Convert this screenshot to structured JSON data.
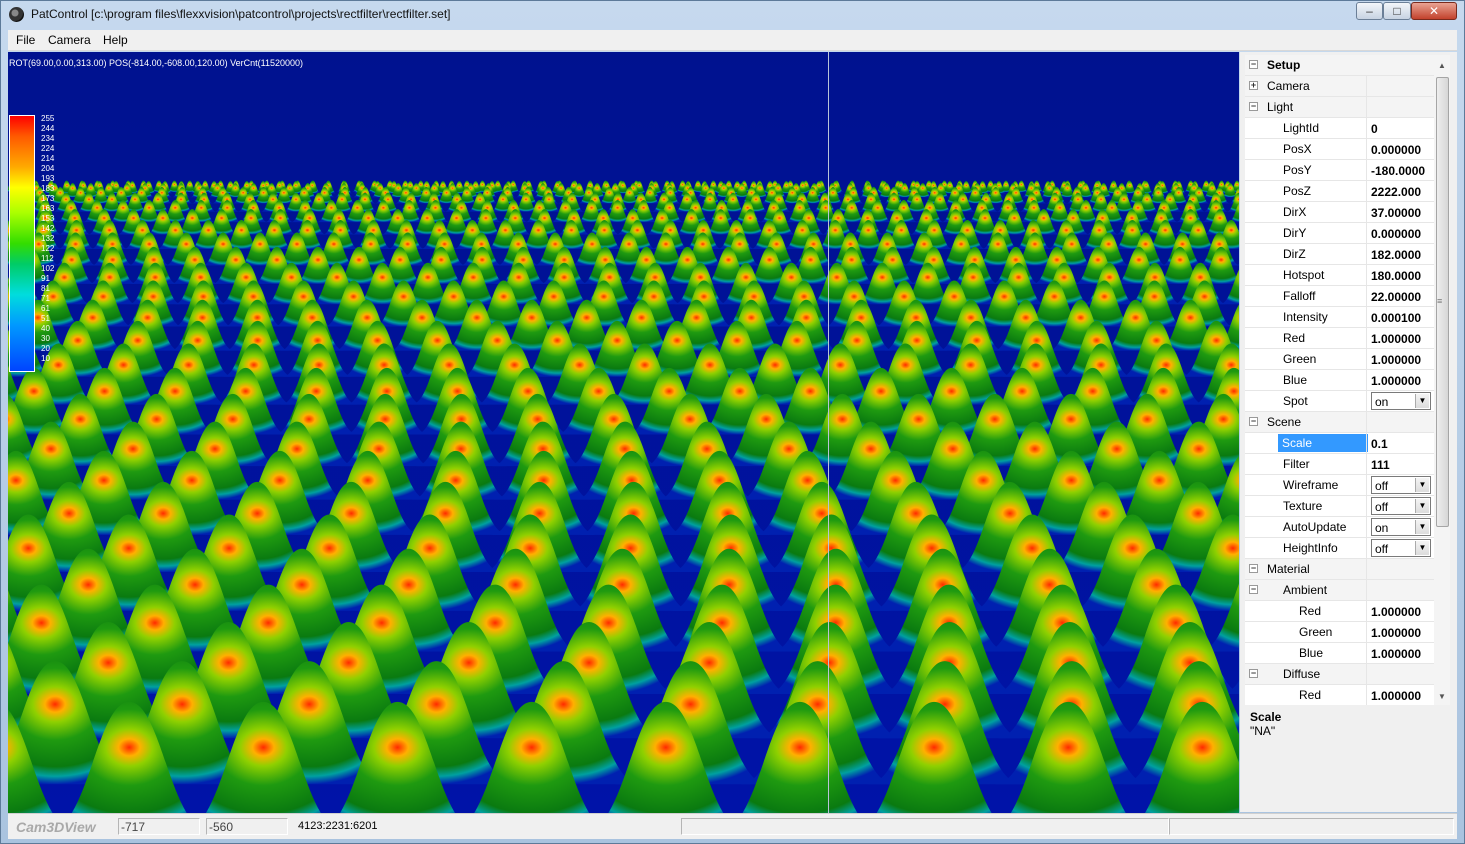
{
  "window": {
    "title": "PatControl [c:\\program files\\flexxvision\\patcontrol\\projects\\rectfilter\\rectfilter.set]",
    "controls": {
      "minimize": "–",
      "maximize": "□",
      "close": "✕"
    }
  },
  "menu": [
    "File",
    "Camera",
    "Help"
  ],
  "viewport": {
    "info": "ROT(69.00,0.00,313.00) POS(-814.00,-608.00,120.00) VerCnt(11520000)",
    "background_color": "#000fa0",
    "legend": [
      "255",
      "244",
      "234",
      "224",
      "214",
      "204",
      "193",
      "183",
      "173",
      "163",
      "153",
      "142",
      "132",
      "122",
      "112",
      "102",
      "91",
      "81",
      "71",
      "61",
      "51",
      "40",
      "30",
      "20",
      "10"
    ]
  },
  "properties": {
    "rows": [
      {
        "label": "Setup",
        "type": "header",
        "expander": "⊟"
      },
      {
        "label": "Camera",
        "type": "cat",
        "expander": "⊞"
      },
      {
        "label": "Light",
        "type": "cat",
        "expander": "⊟"
      },
      {
        "label": "LightId",
        "value": "0"
      },
      {
        "label": "PosX",
        "value": "0.000000"
      },
      {
        "label": "PosY",
        "value": "-180.0000"
      },
      {
        "label": "PosZ",
        "value": "2222.000"
      },
      {
        "label": "DirX",
        "value": "37.00000"
      },
      {
        "label": "DirY",
        "value": "0.000000"
      },
      {
        "label": "DirZ",
        "value": "182.0000"
      },
      {
        "label": "Hotspot",
        "value": "180.0000"
      },
      {
        "label": "Falloff",
        "value": "22.00000"
      },
      {
        "label": "Intensity",
        "value": "0.000100"
      },
      {
        "label": "Red",
        "value": "1.000000"
      },
      {
        "label": "Green",
        "value": "1.000000"
      },
      {
        "label": "Blue",
        "value": "1.000000"
      },
      {
        "label": "Spot",
        "dropdown": "on"
      },
      {
        "label": "Scene",
        "type": "cat",
        "expander": "⊟"
      },
      {
        "label": "Scale",
        "value": "0.1",
        "selected": true
      },
      {
        "label": "Filter",
        "value": "111"
      },
      {
        "label": "Wireframe",
        "dropdown": "off"
      },
      {
        "label": "Texture",
        "dropdown": "off"
      },
      {
        "label": "AutoUpdate",
        "dropdown": "on"
      },
      {
        "label": "HeightInfo",
        "dropdown": "off"
      },
      {
        "label": "Material",
        "type": "cat",
        "expander": "⊟"
      },
      {
        "label": "Ambient",
        "type": "subcat",
        "expander": "⊟"
      },
      {
        "label": "Red",
        "value": "1.000000",
        "level": 2
      },
      {
        "label": "Green",
        "value": "1.000000",
        "level": 2
      },
      {
        "label": "Blue",
        "value": "1.000000",
        "level": 2
      },
      {
        "label": "Diffuse",
        "type": "subcat",
        "expander": "⊟"
      },
      {
        "label": "Red",
        "value": "1.000000",
        "level": 2
      }
    ],
    "description_title": "Scale",
    "description_text": "\"NA\""
  },
  "status": {
    "view_name": "Cam3DView",
    "x": "-717",
    "y": "-560",
    "info": "4123:2231:6201"
  }
}
